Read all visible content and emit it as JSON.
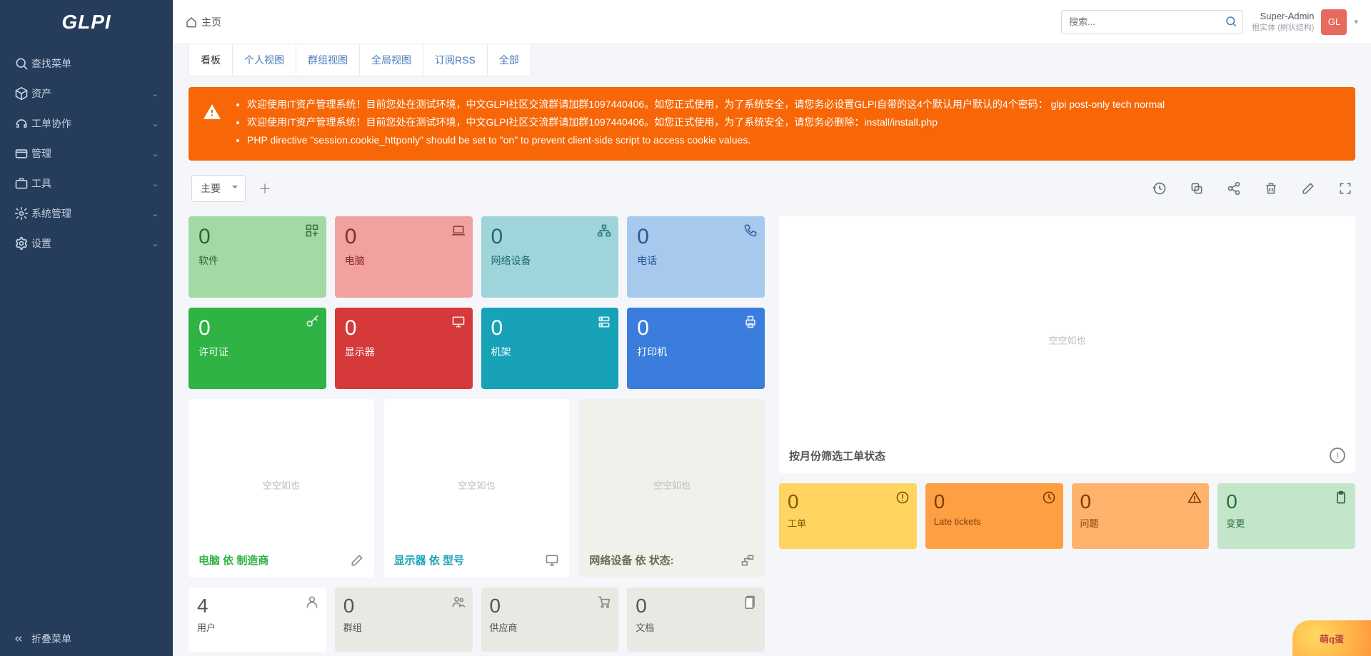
{
  "logo": "GLPI",
  "sidebar": {
    "items": [
      {
        "label": "查找菜单",
        "icon": "search"
      },
      {
        "label": "资产",
        "icon": "cube",
        "expandable": true
      },
      {
        "label": "工单协作",
        "icon": "headset",
        "expandable": true
      },
      {
        "label": "管理",
        "icon": "wallet",
        "expandable": true
      },
      {
        "label": "工具",
        "icon": "briefcase",
        "expandable": true
      },
      {
        "label": "系统管理",
        "icon": "cog",
        "expandable": true
      },
      {
        "label": "设置",
        "icon": "gear",
        "expandable": true
      }
    ],
    "collapse_label": "折叠菜单"
  },
  "breadcrumb": "主页",
  "search_placeholder": "搜索...",
  "user": {
    "name": "Super-Admin",
    "entity": "根实体 (树状结构)",
    "initials": "GL"
  },
  "tabs": [
    "看板",
    "个人视图",
    "群组视图",
    "全局视图",
    "订阅RSS",
    "全部"
  ],
  "active_tab": 0,
  "alerts": [
    "欢迎使用IT资产管理系统！目前您处在测试环境，中文GLPI社区交流群请加群1097440406。如您正式使用，为了系统安全，请您务必设置GLPI自带的这4个默认用户默认的4个密码： glpi post-only tech normal",
    "欢迎使用IT资产管理系统！目前您处在测试环境，中文GLPI社区交流群请加群1097440406。如您正式使用，为了系统安全，请您务必删除：install/install.php",
    "PHP directive \"session.cookie_httponly\" should be set to \"on\" to prevent client-side script to access cookie values."
  ],
  "dashboard": {
    "selector": "主要"
  },
  "tiles_row1": [
    {
      "value": "0",
      "label": "软件",
      "cls": "t-soft-lt",
      "icon": "apps"
    },
    {
      "value": "0",
      "label": "电脑",
      "cls": "t-red-lt",
      "icon": "laptop"
    },
    {
      "value": "0",
      "label": "网络设备",
      "cls": "t-teal-lt",
      "icon": "network"
    },
    {
      "value": "0",
      "label": "电话",
      "cls": "t-blue-lt",
      "icon": "phone"
    }
  ],
  "tiles_row2": [
    {
      "value": "0",
      "label": "许可证",
      "cls": "t-green",
      "icon": "key"
    },
    {
      "value": "0",
      "label": "显示器",
      "cls": "t-red",
      "icon": "monitor"
    },
    {
      "value": "0",
      "label": "机架",
      "cls": "t-teal",
      "icon": "rack"
    },
    {
      "value": "0",
      "label": "打印机",
      "cls": "t-blue",
      "icon": "printer"
    }
  ],
  "empty_text": "空空如也",
  "panels": [
    {
      "title": "电脑 依 制造商",
      "cls": "green-title",
      "icon": "edit"
    },
    {
      "title": "显示器 依 型号",
      "cls": "teal-title",
      "icon": "monitor"
    },
    {
      "title": "网络设备 依 状态:",
      "cls": "olive-title",
      "icon": "network2"
    }
  ],
  "big_panel": {
    "title": "按月份筛选工单状态"
  },
  "status_tiles": [
    {
      "value": "0",
      "label": "工单",
      "cls": "st-yellow",
      "icon": "alert-circle"
    },
    {
      "value": "0",
      "label": "Late tickets",
      "cls": "st-orange",
      "icon": "clock"
    },
    {
      "value": "0",
      "label": "问题",
      "cls": "st-orange2",
      "icon": "warn"
    },
    {
      "value": "0",
      "label": "变更",
      "cls": "st-green",
      "icon": "clipboard"
    }
  ],
  "bottom_tiles": [
    {
      "value": "4",
      "label": "用户",
      "cls": "white",
      "icon": "user"
    },
    {
      "value": "0",
      "label": "群组",
      "cls": "",
      "icon": "users"
    },
    {
      "value": "0",
      "label": "供应商",
      "cls": "",
      "icon": "cart"
    },
    {
      "value": "0",
      "label": "文档",
      "cls": "",
      "icon": "doc"
    }
  ],
  "brand_badge": "萌q蛋"
}
